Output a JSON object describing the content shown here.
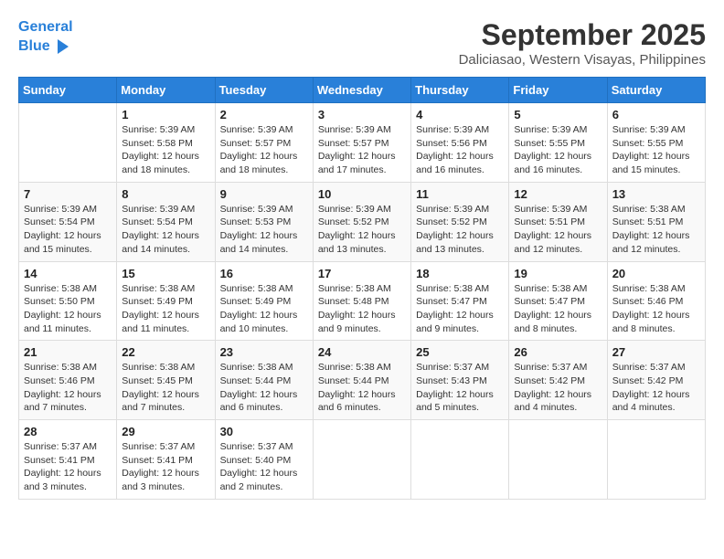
{
  "logo": {
    "line1": "General",
    "line2": "Blue"
  },
  "title": "September 2025",
  "subtitle": "Daliciasao, Western Visayas, Philippines",
  "weekdays": [
    "Sunday",
    "Monday",
    "Tuesday",
    "Wednesday",
    "Thursday",
    "Friday",
    "Saturday"
  ],
  "weeks": [
    [
      {
        "day": "",
        "info": ""
      },
      {
        "day": "1",
        "info": "Sunrise: 5:39 AM\nSunset: 5:58 PM\nDaylight: 12 hours\nand 18 minutes."
      },
      {
        "day": "2",
        "info": "Sunrise: 5:39 AM\nSunset: 5:57 PM\nDaylight: 12 hours\nand 18 minutes."
      },
      {
        "day": "3",
        "info": "Sunrise: 5:39 AM\nSunset: 5:57 PM\nDaylight: 12 hours\nand 17 minutes."
      },
      {
        "day": "4",
        "info": "Sunrise: 5:39 AM\nSunset: 5:56 PM\nDaylight: 12 hours\nand 16 minutes."
      },
      {
        "day": "5",
        "info": "Sunrise: 5:39 AM\nSunset: 5:55 PM\nDaylight: 12 hours\nand 16 minutes."
      },
      {
        "day": "6",
        "info": "Sunrise: 5:39 AM\nSunset: 5:55 PM\nDaylight: 12 hours\nand 15 minutes."
      }
    ],
    [
      {
        "day": "7",
        "info": "Sunrise: 5:39 AM\nSunset: 5:54 PM\nDaylight: 12 hours\nand 15 minutes."
      },
      {
        "day": "8",
        "info": "Sunrise: 5:39 AM\nSunset: 5:54 PM\nDaylight: 12 hours\nand 14 minutes."
      },
      {
        "day": "9",
        "info": "Sunrise: 5:39 AM\nSunset: 5:53 PM\nDaylight: 12 hours\nand 14 minutes."
      },
      {
        "day": "10",
        "info": "Sunrise: 5:39 AM\nSunset: 5:52 PM\nDaylight: 12 hours\nand 13 minutes."
      },
      {
        "day": "11",
        "info": "Sunrise: 5:39 AM\nSunset: 5:52 PM\nDaylight: 12 hours\nand 13 minutes."
      },
      {
        "day": "12",
        "info": "Sunrise: 5:39 AM\nSunset: 5:51 PM\nDaylight: 12 hours\nand 12 minutes."
      },
      {
        "day": "13",
        "info": "Sunrise: 5:38 AM\nSunset: 5:51 PM\nDaylight: 12 hours\nand 12 minutes."
      }
    ],
    [
      {
        "day": "14",
        "info": "Sunrise: 5:38 AM\nSunset: 5:50 PM\nDaylight: 12 hours\nand 11 minutes."
      },
      {
        "day": "15",
        "info": "Sunrise: 5:38 AM\nSunset: 5:49 PM\nDaylight: 12 hours\nand 11 minutes."
      },
      {
        "day": "16",
        "info": "Sunrise: 5:38 AM\nSunset: 5:49 PM\nDaylight: 12 hours\nand 10 minutes."
      },
      {
        "day": "17",
        "info": "Sunrise: 5:38 AM\nSunset: 5:48 PM\nDaylight: 12 hours\nand 9 minutes."
      },
      {
        "day": "18",
        "info": "Sunrise: 5:38 AM\nSunset: 5:47 PM\nDaylight: 12 hours\nand 9 minutes."
      },
      {
        "day": "19",
        "info": "Sunrise: 5:38 AM\nSunset: 5:47 PM\nDaylight: 12 hours\nand 8 minutes."
      },
      {
        "day": "20",
        "info": "Sunrise: 5:38 AM\nSunset: 5:46 PM\nDaylight: 12 hours\nand 8 minutes."
      }
    ],
    [
      {
        "day": "21",
        "info": "Sunrise: 5:38 AM\nSunset: 5:46 PM\nDaylight: 12 hours\nand 7 minutes."
      },
      {
        "day": "22",
        "info": "Sunrise: 5:38 AM\nSunset: 5:45 PM\nDaylight: 12 hours\nand 7 minutes."
      },
      {
        "day": "23",
        "info": "Sunrise: 5:38 AM\nSunset: 5:44 PM\nDaylight: 12 hours\nand 6 minutes."
      },
      {
        "day": "24",
        "info": "Sunrise: 5:38 AM\nSunset: 5:44 PM\nDaylight: 12 hours\nand 6 minutes."
      },
      {
        "day": "25",
        "info": "Sunrise: 5:37 AM\nSunset: 5:43 PM\nDaylight: 12 hours\nand 5 minutes."
      },
      {
        "day": "26",
        "info": "Sunrise: 5:37 AM\nSunset: 5:42 PM\nDaylight: 12 hours\nand 4 minutes."
      },
      {
        "day": "27",
        "info": "Sunrise: 5:37 AM\nSunset: 5:42 PM\nDaylight: 12 hours\nand 4 minutes."
      }
    ],
    [
      {
        "day": "28",
        "info": "Sunrise: 5:37 AM\nSunset: 5:41 PM\nDaylight: 12 hours\nand 3 minutes."
      },
      {
        "day": "29",
        "info": "Sunrise: 5:37 AM\nSunset: 5:41 PM\nDaylight: 12 hours\nand 3 minutes."
      },
      {
        "day": "30",
        "info": "Sunrise: 5:37 AM\nSunset: 5:40 PM\nDaylight: 12 hours\nand 2 minutes."
      },
      {
        "day": "",
        "info": ""
      },
      {
        "day": "",
        "info": ""
      },
      {
        "day": "",
        "info": ""
      },
      {
        "day": "",
        "info": ""
      }
    ]
  ]
}
